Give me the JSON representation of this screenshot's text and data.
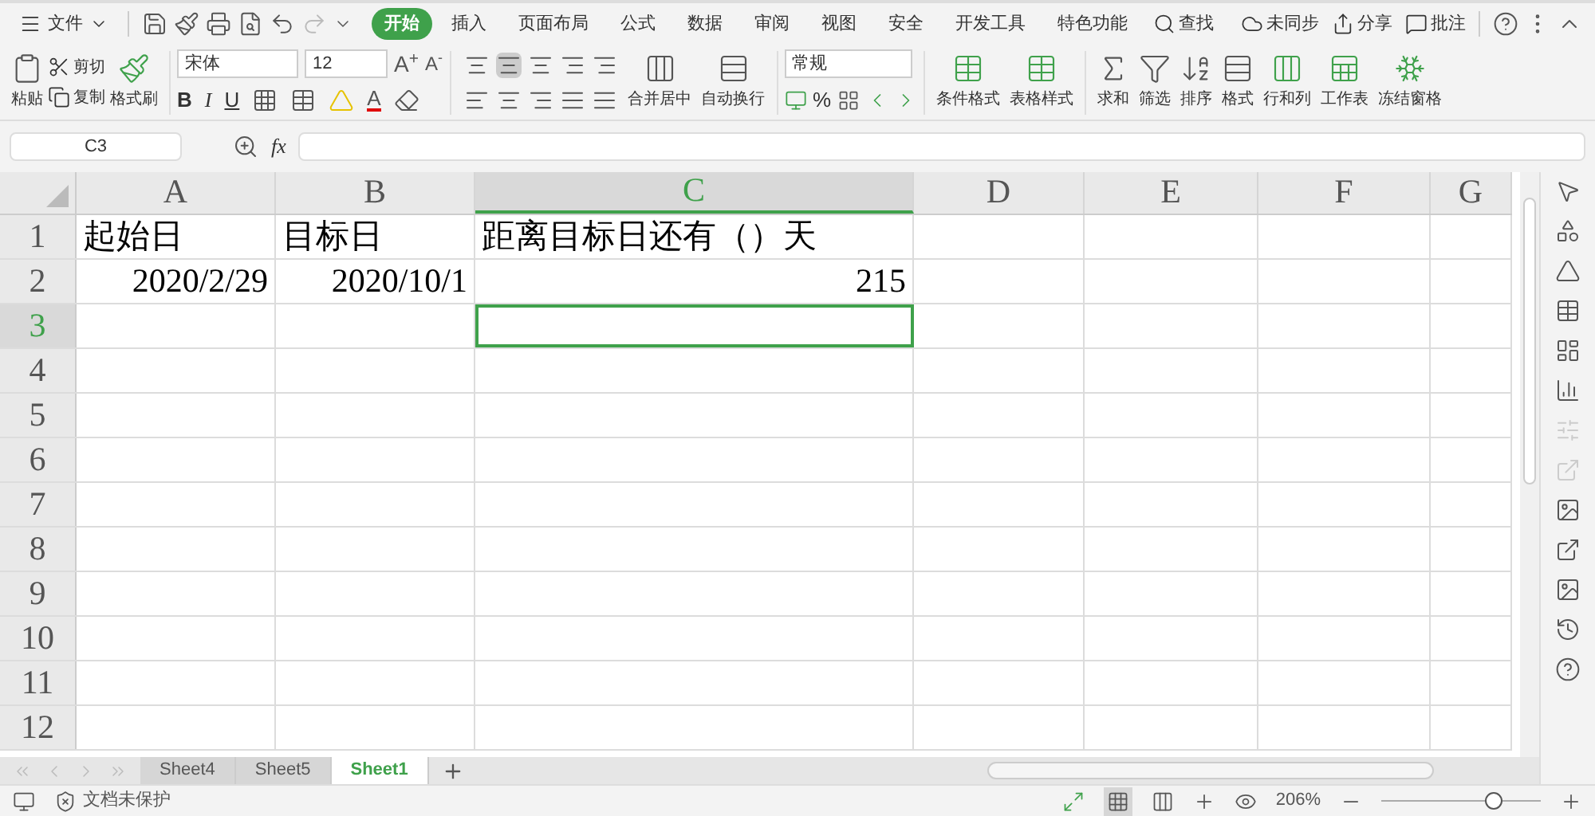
{
  "menu": {
    "file": "文件",
    "tabs": [
      {
        "label": "开始",
        "selected": true
      },
      {
        "label": "插入",
        "selected": false
      },
      {
        "label": "页面布局",
        "selected": false
      },
      {
        "label": "公式",
        "selected": false
      },
      {
        "label": "数据",
        "selected": false
      },
      {
        "label": "审阅",
        "selected": false
      },
      {
        "label": "视图",
        "selected": false
      },
      {
        "label": "安全",
        "selected": false
      },
      {
        "label": "开发工具",
        "selected": false
      },
      {
        "label": "特色功能",
        "selected": false
      }
    ],
    "search": "查找",
    "sync": "未同步",
    "share": "分享",
    "comment": "批注"
  },
  "ribbon": {
    "paste": "粘贴",
    "cut": "剪切",
    "copy": "复制",
    "format_painter": "格式刷",
    "font": "宋体",
    "font_size": "12",
    "grow_font": "A$^{+}$",
    "shrink_font": "A$^{-}$",
    "font_color": "A",
    "bold": "B",
    "italic": "I",
    "underline": "U",
    "merge": "合并居中",
    "wrap": "自动换行",
    "number_format": "常规",
    "percent": "%",
    "conditional": "条件格式",
    "table_style": "表格样式",
    "sum": "求和",
    "filter": "筛选",
    "sort": "排序",
    "format": "格式",
    "rows_cols": "行和列",
    "worksheet": "工作表",
    "freeze": "冻结窗格"
  },
  "formula_bar": {
    "name_box": "C3",
    "fx": "fx"
  },
  "columns": [
    {
      "label": "A",
      "selected": false
    },
    {
      "label": "B",
      "selected": false
    },
    {
      "label": "C",
      "selected": true
    },
    {
      "label": "D",
      "selected": false
    },
    {
      "label": "E",
      "selected": false
    },
    {
      "label": "F",
      "selected": false
    },
    {
      "label": "G",
      "selected": false
    }
  ],
  "rows": [
    {
      "number": "1",
      "selected": false,
      "cells": [
        {
          "text": "起始日",
          "kind": "text"
        },
        {
          "text": "目标日",
          "kind": "text"
        },
        {
          "text": "距离目标日还有（）天",
          "kind": "text"
        }
      ]
    },
    {
      "number": "2",
      "selected": false,
      "cells": [
        {
          "text": "2020/2/29",
          "kind": "number"
        },
        {
          "text": "2020/10/1",
          "kind": "number"
        },
        {
          "text": "215",
          "kind": "number"
        }
      ]
    },
    {
      "number": "3",
      "selected": true,
      "cells": []
    },
    {
      "number": "4",
      "selected": false,
      "cells": []
    },
    {
      "number": "5",
      "selected": false,
      "cells": []
    },
    {
      "number": "6",
      "selected": false,
      "cells": []
    },
    {
      "number": "7",
      "selected": false,
      "cells": []
    },
    {
      "number": "8",
      "selected": false,
      "cells": []
    },
    {
      "number": "9",
      "selected": false,
      "cells": []
    },
    {
      "number": "10",
      "selected": false,
      "cells": []
    },
    {
      "number": "11",
      "selected": false,
      "cells": []
    },
    {
      "number": "12",
      "selected": false,
      "cells": []
    }
  ],
  "sheets": [
    {
      "label": "Sheet4",
      "selected": false
    },
    {
      "label": "Sheet5",
      "selected": false
    },
    {
      "label": "Sheet1",
      "selected": true
    }
  ],
  "status_bar": {
    "protection": "文档未保护",
    "zoom": "206%",
    "level": 0.7
  }
}
